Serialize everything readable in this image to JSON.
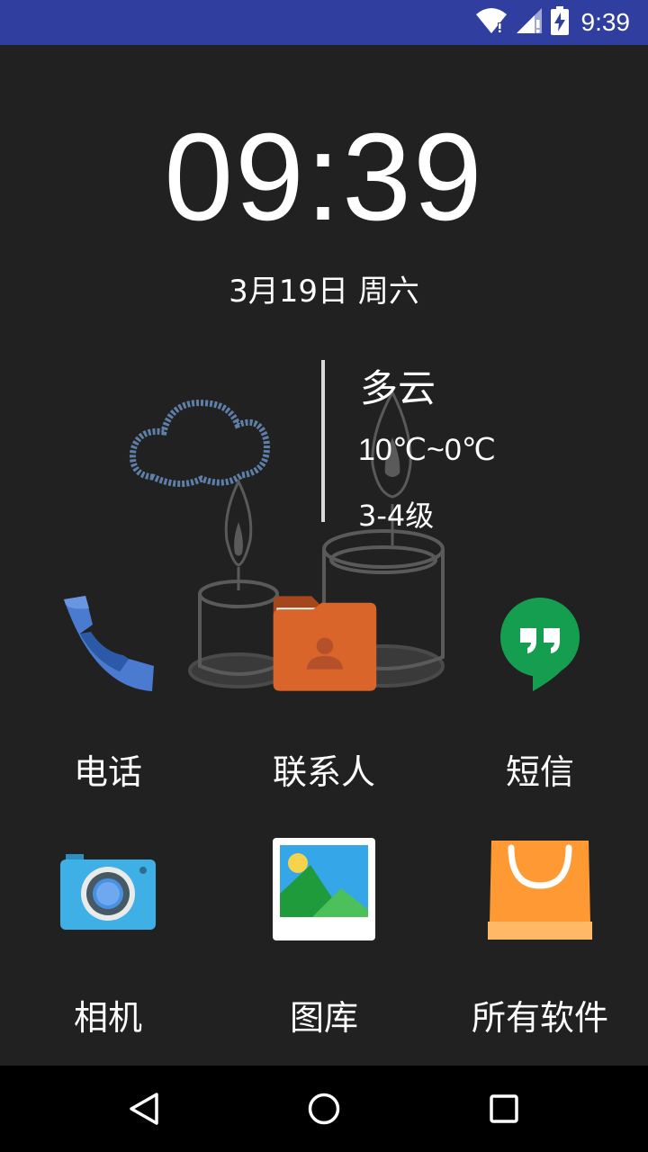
{
  "status_bar": {
    "time": "9:39",
    "icons": [
      "wifi-icon",
      "signal-icon",
      "battery-charging-icon"
    ]
  },
  "clock": {
    "time": "09:39",
    "date": "3月19日 周六"
  },
  "weather": {
    "condition": "多云",
    "temperature": "10℃~0℃",
    "wind": "3-4级",
    "icon": "cloud-icon"
  },
  "apps": [
    {
      "label": "电话",
      "icon": "phone-icon"
    },
    {
      "label": "联系人",
      "icon": "contacts-folder-icon"
    },
    {
      "label": "短信",
      "icon": "hangouts-messages-icon"
    },
    {
      "label": "相机",
      "icon": "camera-icon"
    },
    {
      "label": "图库",
      "icon": "gallery-icon"
    },
    {
      "label": "所有软件",
      "icon": "all-apps-bag-icon"
    }
  ],
  "nav_bar": {
    "buttons": [
      "back-icon",
      "home-icon",
      "recents-icon"
    ]
  },
  "colors": {
    "status_bar": "#303F9F",
    "background": "#212121",
    "nav_bar": "#000000",
    "phone": "#4A7BD0",
    "contacts": "#D9652B",
    "hangouts": "#159E4F",
    "camera": "#3FB0E5",
    "shop": "#FF9933"
  }
}
